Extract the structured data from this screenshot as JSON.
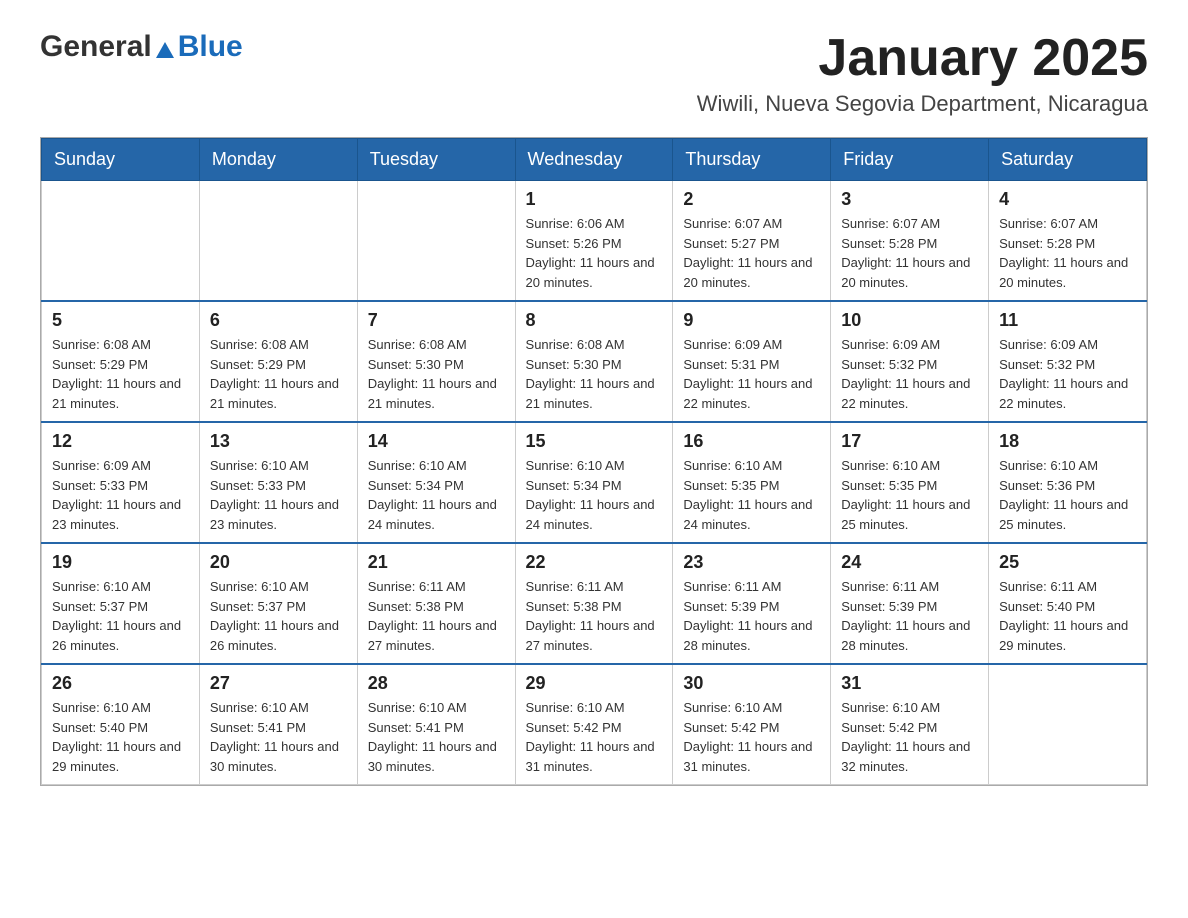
{
  "logo": {
    "general": "General",
    "blue": "Blue",
    "triangle": "▲"
  },
  "title": "January 2025",
  "location": "Wiwili, Nueva Segovia Department, Nicaragua",
  "days_of_week": [
    "Sunday",
    "Monday",
    "Tuesday",
    "Wednesday",
    "Thursday",
    "Friday",
    "Saturday"
  ],
  "weeks": [
    [
      {
        "day": "",
        "info": ""
      },
      {
        "day": "",
        "info": ""
      },
      {
        "day": "",
        "info": ""
      },
      {
        "day": "1",
        "info": "Sunrise: 6:06 AM\nSunset: 5:26 PM\nDaylight: 11 hours and 20 minutes."
      },
      {
        "day": "2",
        "info": "Sunrise: 6:07 AM\nSunset: 5:27 PM\nDaylight: 11 hours and 20 minutes."
      },
      {
        "day": "3",
        "info": "Sunrise: 6:07 AM\nSunset: 5:28 PM\nDaylight: 11 hours and 20 minutes."
      },
      {
        "day": "4",
        "info": "Sunrise: 6:07 AM\nSunset: 5:28 PM\nDaylight: 11 hours and 20 minutes."
      }
    ],
    [
      {
        "day": "5",
        "info": "Sunrise: 6:08 AM\nSunset: 5:29 PM\nDaylight: 11 hours and 21 minutes."
      },
      {
        "day": "6",
        "info": "Sunrise: 6:08 AM\nSunset: 5:29 PM\nDaylight: 11 hours and 21 minutes."
      },
      {
        "day": "7",
        "info": "Sunrise: 6:08 AM\nSunset: 5:30 PM\nDaylight: 11 hours and 21 minutes."
      },
      {
        "day": "8",
        "info": "Sunrise: 6:08 AM\nSunset: 5:30 PM\nDaylight: 11 hours and 21 minutes."
      },
      {
        "day": "9",
        "info": "Sunrise: 6:09 AM\nSunset: 5:31 PM\nDaylight: 11 hours and 22 minutes."
      },
      {
        "day": "10",
        "info": "Sunrise: 6:09 AM\nSunset: 5:32 PM\nDaylight: 11 hours and 22 minutes."
      },
      {
        "day": "11",
        "info": "Sunrise: 6:09 AM\nSunset: 5:32 PM\nDaylight: 11 hours and 22 minutes."
      }
    ],
    [
      {
        "day": "12",
        "info": "Sunrise: 6:09 AM\nSunset: 5:33 PM\nDaylight: 11 hours and 23 minutes."
      },
      {
        "day": "13",
        "info": "Sunrise: 6:10 AM\nSunset: 5:33 PM\nDaylight: 11 hours and 23 minutes."
      },
      {
        "day": "14",
        "info": "Sunrise: 6:10 AM\nSunset: 5:34 PM\nDaylight: 11 hours and 24 minutes."
      },
      {
        "day": "15",
        "info": "Sunrise: 6:10 AM\nSunset: 5:34 PM\nDaylight: 11 hours and 24 minutes."
      },
      {
        "day": "16",
        "info": "Sunrise: 6:10 AM\nSunset: 5:35 PM\nDaylight: 11 hours and 24 minutes."
      },
      {
        "day": "17",
        "info": "Sunrise: 6:10 AM\nSunset: 5:35 PM\nDaylight: 11 hours and 25 minutes."
      },
      {
        "day": "18",
        "info": "Sunrise: 6:10 AM\nSunset: 5:36 PM\nDaylight: 11 hours and 25 minutes."
      }
    ],
    [
      {
        "day": "19",
        "info": "Sunrise: 6:10 AM\nSunset: 5:37 PM\nDaylight: 11 hours and 26 minutes."
      },
      {
        "day": "20",
        "info": "Sunrise: 6:10 AM\nSunset: 5:37 PM\nDaylight: 11 hours and 26 minutes."
      },
      {
        "day": "21",
        "info": "Sunrise: 6:11 AM\nSunset: 5:38 PM\nDaylight: 11 hours and 27 minutes."
      },
      {
        "day": "22",
        "info": "Sunrise: 6:11 AM\nSunset: 5:38 PM\nDaylight: 11 hours and 27 minutes."
      },
      {
        "day": "23",
        "info": "Sunrise: 6:11 AM\nSunset: 5:39 PM\nDaylight: 11 hours and 28 minutes."
      },
      {
        "day": "24",
        "info": "Sunrise: 6:11 AM\nSunset: 5:39 PM\nDaylight: 11 hours and 28 minutes."
      },
      {
        "day": "25",
        "info": "Sunrise: 6:11 AM\nSunset: 5:40 PM\nDaylight: 11 hours and 29 minutes."
      }
    ],
    [
      {
        "day": "26",
        "info": "Sunrise: 6:10 AM\nSunset: 5:40 PM\nDaylight: 11 hours and 29 minutes."
      },
      {
        "day": "27",
        "info": "Sunrise: 6:10 AM\nSunset: 5:41 PM\nDaylight: 11 hours and 30 minutes."
      },
      {
        "day": "28",
        "info": "Sunrise: 6:10 AM\nSunset: 5:41 PM\nDaylight: 11 hours and 30 minutes."
      },
      {
        "day": "29",
        "info": "Sunrise: 6:10 AM\nSunset: 5:42 PM\nDaylight: 11 hours and 31 minutes."
      },
      {
        "day": "30",
        "info": "Sunrise: 6:10 AM\nSunset: 5:42 PM\nDaylight: 11 hours and 31 minutes."
      },
      {
        "day": "31",
        "info": "Sunrise: 6:10 AM\nSunset: 5:42 PM\nDaylight: 11 hours and 32 minutes."
      },
      {
        "day": "",
        "info": ""
      }
    ]
  ]
}
